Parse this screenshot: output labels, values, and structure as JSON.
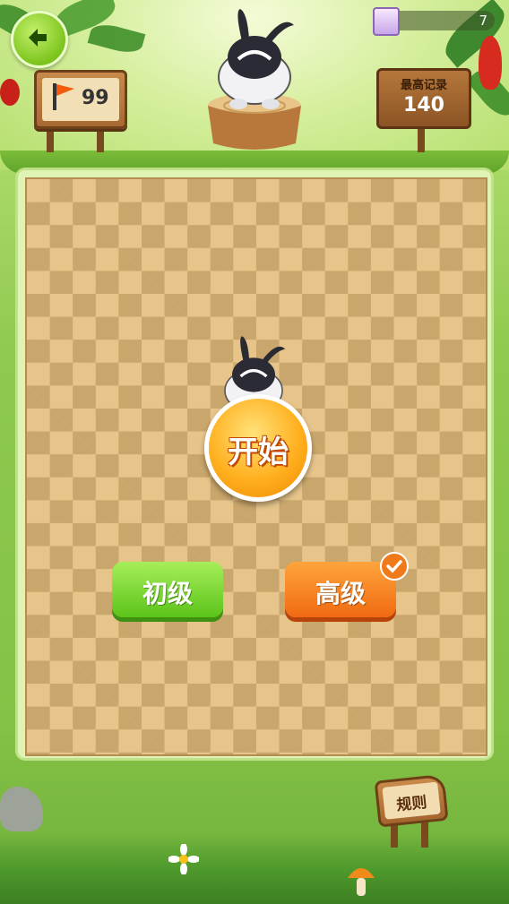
{
  "header": {
    "level_count": "99",
    "coins": "7",
    "record_label": "最高记录",
    "record_value": "140"
  },
  "game": {
    "start_label": "开始",
    "difficulty": {
      "easy_label": "初级",
      "hard_label": "高级",
      "selected": "hard"
    }
  },
  "footer": {
    "rules_label": "规则"
  },
  "icons": {
    "back": "arrow-left-icon",
    "flag": "flag-icon",
    "gem": "gem-icon",
    "check": "checkmark-icon",
    "mascot": "skunk-mascot-icon"
  },
  "colors": {
    "accent_green": "#7cc41d",
    "accent_orange": "#f06a12",
    "board_light": "#e6c48a",
    "board_dark": "#c9a66b"
  }
}
